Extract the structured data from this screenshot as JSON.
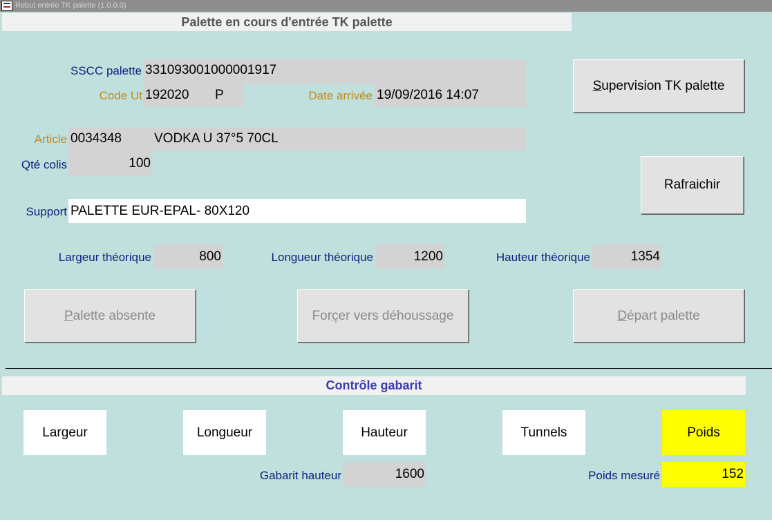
{
  "window": {
    "title": "Rebut entrée TK palette (1.0.0.0)"
  },
  "section_top": {
    "title": "Palette en cours d'entrée TK palette"
  },
  "fields": {
    "sscc": {
      "label": "SSCC palette",
      "value": "331093001000001917"
    },
    "code_ut": {
      "label": "Code Ut",
      "value": "192020",
      "suffix": "P"
    },
    "date_arrivee": {
      "label": "Date arrivée",
      "value": "19/09/2016 14:07"
    },
    "article": {
      "label": "Article",
      "code": "0034348",
      "description": "VODKA U 37°5 70CL"
    },
    "qte_colis": {
      "label": "Qté colis",
      "value": "100"
    },
    "support": {
      "label": "Support",
      "value": "PALETTE EUR-EPAL- 80X120"
    },
    "largeur_theorique": {
      "label": "Largeur théorique",
      "value": "800"
    },
    "longueur_theorique": {
      "label": "Longueur théorique",
      "value": "1200"
    },
    "hauteur_theorique": {
      "label": "Hauteur théorique",
      "value": "1354"
    }
  },
  "buttons": {
    "supervision": {
      "mnemonic": "S",
      "rest": "upervision TK palette"
    },
    "rafraichir": {
      "label": "Rafraichir"
    },
    "palette_absente": {
      "mnemonic": "P",
      "rest": "alette absente"
    },
    "forcer": {
      "pre": "For",
      "mnemonic": "ç",
      "rest": "er vers déhoussage"
    },
    "depart": {
      "mnemonic": "D",
      "rest": "épart palette"
    }
  },
  "section_bottom": {
    "title": "Contrôle gabarit"
  },
  "controls": {
    "largeur": "Largeur",
    "longueur": "Longueur",
    "hauteur": "Hauteur",
    "tunnels": "Tunnels",
    "poids": "Poids"
  },
  "measures": {
    "gabarit_hauteur": {
      "label": "Gabarit hauteur",
      "value": "1600"
    },
    "poids_mesure": {
      "label": "Poids mesuré",
      "value": "152"
    }
  },
  "colors": {
    "background": "#bfe0dd",
    "label_blue": "#0a1f7f",
    "label_orange": "#c48a1b",
    "section_bottom_title": "#3b3bb5",
    "highlight_yellow": "#ffff00",
    "value_gray": "#d3d3d3"
  }
}
